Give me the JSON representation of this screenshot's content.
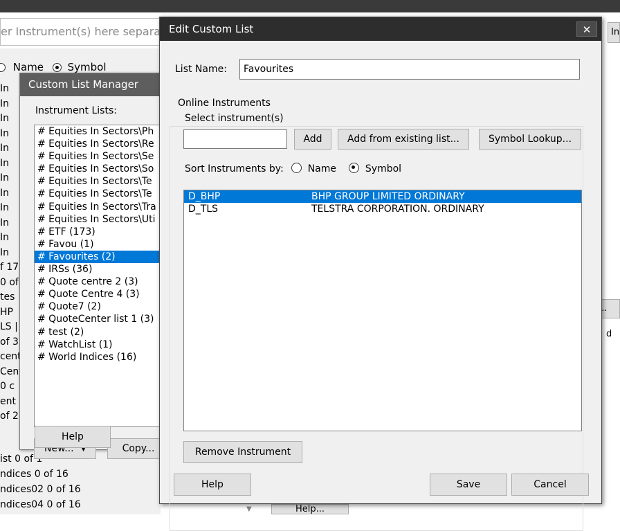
{
  "background_app": {
    "instrument_input_placeholder": "er Instrument(s) here separat",
    "search_by": {
      "name_label": "Name",
      "symbol_label": "Symbol",
      "selected": "Symbol"
    },
    "left_rows": [
      "In",
      "In",
      "In",
      "In",
      "In",
      "In",
      "In",
      "In",
      "In",
      "In",
      "In",
      "In",
      "f 17",
      "0 of",
      "tes",
      "HP",
      "LS |",
      "of 3",
      "cent",
      "Cent",
      "0 c",
      "ent",
      "of 2"
    ],
    "bottom_rows": [
      "ist  0 of 1",
      "ndices  0 of 16",
      "ndices02  0 of 16",
      "ndices04  0 of 16"
    ],
    "right_button_in": "In",
    "right_button_e": "e...",
    "right_text_d": "d",
    "help_button_label": "Help..."
  },
  "custom_list_manager": {
    "title": "Custom List Manager",
    "instrument_lists_label": "Instrument Lists:",
    "items": [
      "# Equities In Sectors\\Ph",
      "# Equities In Sectors\\Re",
      "# Equities In Sectors\\Se",
      "# Equities In Sectors\\So",
      "# Equities In Sectors\\Te",
      "# Equities In Sectors\\Te",
      "# Equities In Sectors\\Tra",
      "# Equities In Sectors\\Uti",
      "# ETF (173)",
      "# Favou (1)",
      "# Favourites (2)",
      "# IRSs (36)",
      "# Quote centre 2 (3)",
      "# Quote Centre 4 (3)",
      "# Quote7 (2)",
      "# QuoteCenter list 1 (3)",
      "# test (2)",
      "# WatchList (1)",
      "# World Indices (16)"
    ],
    "selected_item": "# Favourites (2)",
    "new_button": "New...",
    "copy_button": "Copy...",
    "help_button": "Help"
  },
  "edit_dialog": {
    "title": "Edit Custom List",
    "close_label": "✕",
    "list_name_label": "List Name:",
    "list_name_value": "Favourites",
    "online_instruments_label": "Online Instruments",
    "select_instruments_label": "Select instrument(s)",
    "select_input_value": "",
    "add_button": "Add",
    "add_from_list_button": "Add from existing list...",
    "symbol_lookup_button": "Symbol Lookup...",
    "sort_label": "Sort Instruments by:",
    "sort_name_label": "Name",
    "sort_symbol_label": "Symbol",
    "sort_selected": "Symbol",
    "instruments": [
      {
        "symbol": "D_BHP",
        "name": "BHP GROUP LIMITED ORDINARY",
        "selected": true
      },
      {
        "symbol": "D_TLS",
        "name": "TELSTRA CORPORATION. ORDINARY",
        "selected": false
      }
    ],
    "remove_button": "Remove Instrument",
    "help_button": "Help",
    "save_button": "Save",
    "cancel_button": "Cancel"
  },
  "colors": {
    "selection": "#0078d7",
    "dialog_title_bar": "#2d2d2d",
    "manager_title_bar": "#5e5e5e",
    "window_bg": "#f0f0f0"
  }
}
